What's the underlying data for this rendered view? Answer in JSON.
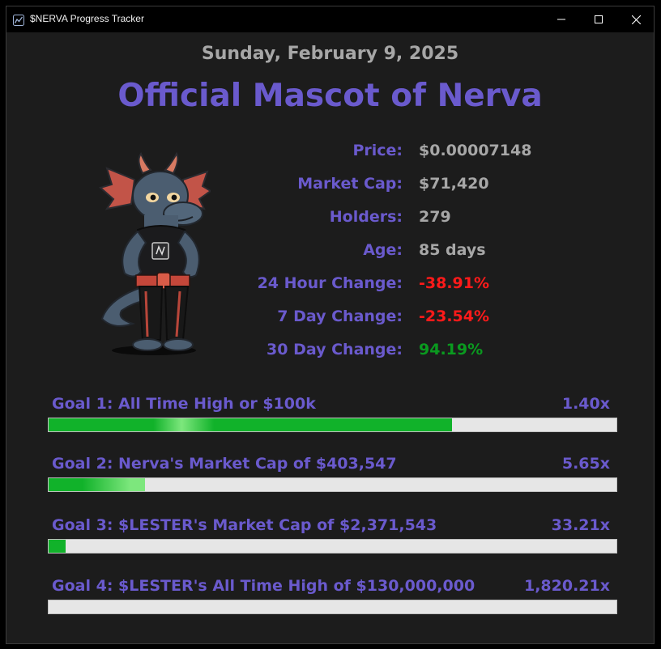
{
  "window": {
    "title": "$NERVA Progress Tracker",
    "icon": "chart-icon"
  },
  "date": "Sunday, February 9, 2025",
  "headline": "Official Mascot of Nerva",
  "mascot_icon": "dragon-mascot-illustration",
  "stats": [
    {
      "label": "Price:",
      "value": "$0.00007148",
      "tone": "neutral"
    },
    {
      "label": "Market Cap:",
      "value": "$71,420",
      "tone": "neutral"
    },
    {
      "label": "Holders:",
      "value": "279",
      "tone": "neutral"
    },
    {
      "label": "Age:",
      "value": "85 days",
      "tone": "neutral"
    },
    {
      "label": "24 Hour Change:",
      "value": "-38.91%",
      "tone": "negative"
    },
    {
      "label": "7 Day Change:",
      "value": "-23.54%",
      "tone": "negative"
    },
    {
      "label": "30 Day Change:",
      "value": "94.19%",
      "tone": "positive"
    }
  ],
  "goals": [
    {
      "label": "Goal 1: All Time High or $100k",
      "multiplier": "1.40x",
      "progress": 0.71
    },
    {
      "label": "Goal 2: Nerva's Market Cap of $403,547",
      "multiplier": "5.65x",
      "progress": 0.17
    },
    {
      "label": "Goal 3: $LESTER's Market Cap of $2,371,543",
      "multiplier": "33.21x",
      "progress": 0.03
    },
    {
      "label": "Goal 4: $LESTER's All Time High of $130,000,000",
      "multiplier": "1,820.21x",
      "progress": 0.0
    }
  ],
  "colors": {
    "accent": "#6a5acd",
    "neutral_text": "#a7a7a7",
    "negative": "#ff1a1a",
    "positive": "#0a9a1f",
    "progress_green": "#11b22a",
    "progress_highlight": "#7de77d",
    "track": "#e6e6e6"
  }
}
